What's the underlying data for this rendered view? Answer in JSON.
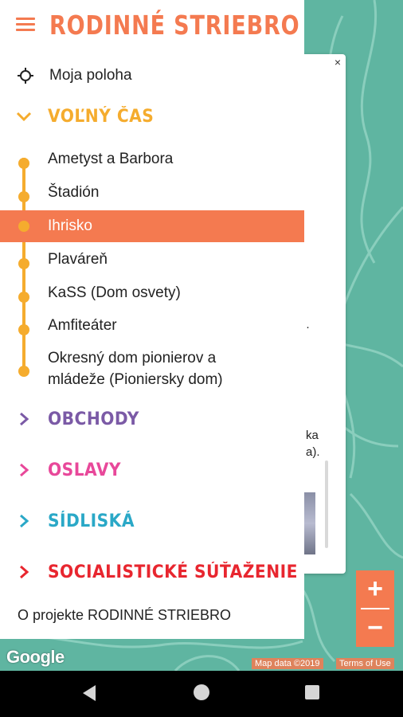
{
  "app": {
    "title": "RODINNÉ STRIEBRO"
  },
  "my_location": {
    "label": "Moja poloha"
  },
  "sections": [
    {
      "label": "VOĽNÝ ČAS",
      "color": "#f5ac2e",
      "expanded": true
    },
    {
      "label": "OBCHODY",
      "color": "#7b5aa6",
      "expanded": false
    },
    {
      "label": "OSLAVY",
      "color": "#e8489a",
      "expanded": false
    },
    {
      "label": "SÍDLISKÁ",
      "color": "#2aa8c7",
      "expanded": false
    },
    {
      "label": "SOCIALISTICKÉ SÚŤAŽENIE",
      "color": "#e8262f",
      "expanded": false
    }
  ],
  "leisure_items": [
    {
      "label": "Ametyst a Barbora"
    },
    {
      "label": "Štadión"
    },
    {
      "label": "Ihrisko",
      "selected": true
    },
    {
      "label": "Plaváreň"
    },
    {
      "label": "KaSS (Dom osvety)"
    },
    {
      "label": "Amfiteáter"
    },
    {
      "label": "Okresný dom pionierov a mládeže (Pioniersky dom)"
    }
  ],
  "about": {
    "label": "O projekte RODINNÉ STRIEBRO"
  },
  "map": {
    "google_logo": "Google",
    "map_data": "Map data ©2019",
    "terms": "Terms of Use",
    "popup_close": "×",
    "popup_text_1": "ka",
    "popup_text_2": "a).",
    "popup_text_3": "·"
  },
  "zoom": {
    "in": "+",
    "out": "−"
  },
  "colors": {
    "accent": "#f47a50",
    "timeline": "#f5ac2e",
    "map": "#5fb5a1"
  },
  "icons": [
    "menu-icon",
    "crosshair-icon",
    "chevron-down-icon",
    "chevron-right-icon",
    "close-icon",
    "back-icon",
    "home-icon",
    "recents-icon"
  ]
}
